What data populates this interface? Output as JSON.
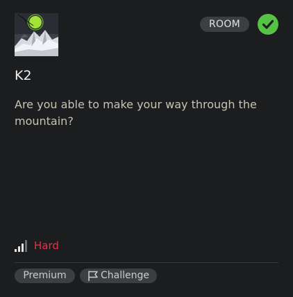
{
  "card": {
    "type_badge": "ROOM",
    "title": "K2",
    "description": "Are you able to make your way through the mountain?",
    "difficulty": "Hard",
    "tags": [
      "Premium",
      "Challenge"
    ]
  },
  "colors": {
    "background": "#1c1d1f",
    "badge": "#3b3e43",
    "completed": "#56c243",
    "difficulty_hard": "#ee2f45",
    "description": "#c9c2b4"
  },
  "icons": {
    "completed": "check-circle-icon",
    "difficulty": "signal-bars-icon",
    "challenge": "flag-icon"
  }
}
